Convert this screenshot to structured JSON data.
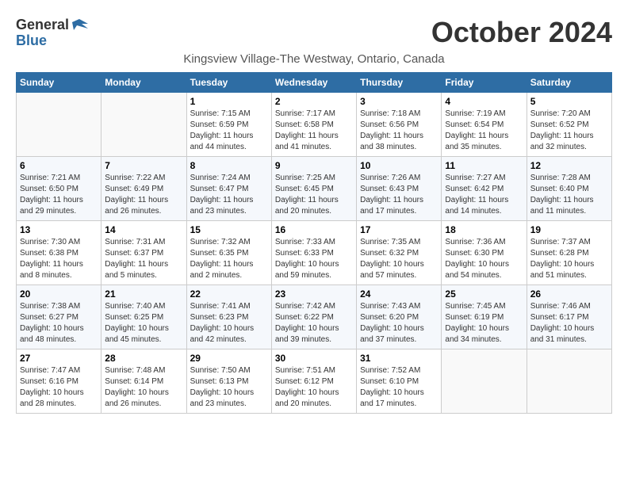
{
  "logo": {
    "general": "General",
    "blue": "Blue"
  },
  "title": "October 2024",
  "subtitle": "Kingsview Village-The Westway, Ontario, Canada",
  "days_of_week": [
    "Sunday",
    "Monday",
    "Tuesday",
    "Wednesday",
    "Thursday",
    "Friday",
    "Saturday"
  ],
  "weeks": [
    [
      {
        "day": "",
        "info": ""
      },
      {
        "day": "",
        "info": ""
      },
      {
        "day": "1",
        "info": "Sunrise: 7:15 AM\nSunset: 6:59 PM\nDaylight: 11 hours and 44 minutes."
      },
      {
        "day": "2",
        "info": "Sunrise: 7:17 AM\nSunset: 6:58 PM\nDaylight: 11 hours and 41 minutes."
      },
      {
        "day": "3",
        "info": "Sunrise: 7:18 AM\nSunset: 6:56 PM\nDaylight: 11 hours and 38 minutes."
      },
      {
        "day": "4",
        "info": "Sunrise: 7:19 AM\nSunset: 6:54 PM\nDaylight: 11 hours and 35 minutes."
      },
      {
        "day": "5",
        "info": "Sunrise: 7:20 AM\nSunset: 6:52 PM\nDaylight: 11 hours and 32 minutes."
      }
    ],
    [
      {
        "day": "6",
        "info": "Sunrise: 7:21 AM\nSunset: 6:50 PM\nDaylight: 11 hours and 29 minutes."
      },
      {
        "day": "7",
        "info": "Sunrise: 7:22 AM\nSunset: 6:49 PM\nDaylight: 11 hours and 26 minutes."
      },
      {
        "day": "8",
        "info": "Sunrise: 7:24 AM\nSunset: 6:47 PM\nDaylight: 11 hours and 23 minutes."
      },
      {
        "day": "9",
        "info": "Sunrise: 7:25 AM\nSunset: 6:45 PM\nDaylight: 11 hours and 20 minutes."
      },
      {
        "day": "10",
        "info": "Sunrise: 7:26 AM\nSunset: 6:43 PM\nDaylight: 11 hours and 17 minutes."
      },
      {
        "day": "11",
        "info": "Sunrise: 7:27 AM\nSunset: 6:42 PM\nDaylight: 11 hours and 14 minutes."
      },
      {
        "day": "12",
        "info": "Sunrise: 7:28 AM\nSunset: 6:40 PM\nDaylight: 11 hours and 11 minutes."
      }
    ],
    [
      {
        "day": "13",
        "info": "Sunrise: 7:30 AM\nSunset: 6:38 PM\nDaylight: 11 hours and 8 minutes."
      },
      {
        "day": "14",
        "info": "Sunrise: 7:31 AM\nSunset: 6:37 PM\nDaylight: 11 hours and 5 minutes."
      },
      {
        "day": "15",
        "info": "Sunrise: 7:32 AM\nSunset: 6:35 PM\nDaylight: 11 hours and 2 minutes."
      },
      {
        "day": "16",
        "info": "Sunrise: 7:33 AM\nSunset: 6:33 PM\nDaylight: 10 hours and 59 minutes."
      },
      {
        "day": "17",
        "info": "Sunrise: 7:35 AM\nSunset: 6:32 PM\nDaylight: 10 hours and 57 minutes."
      },
      {
        "day": "18",
        "info": "Sunrise: 7:36 AM\nSunset: 6:30 PM\nDaylight: 10 hours and 54 minutes."
      },
      {
        "day": "19",
        "info": "Sunrise: 7:37 AM\nSunset: 6:28 PM\nDaylight: 10 hours and 51 minutes."
      }
    ],
    [
      {
        "day": "20",
        "info": "Sunrise: 7:38 AM\nSunset: 6:27 PM\nDaylight: 10 hours and 48 minutes."
      },
      {
        "day": "21",
        "info": "Sunrise: 7:40 AM\nSunset: 6:25 PM\nDaylight: 10 hours and 45 minutes."
      },
      {
        "day": "22",
        "info": "Sunrise: 7:41 AM\nSunset: 6:23 PM\nDaylight: 10 hours and 42 minutes."
      },
      {
        "day": "23",
        "info": "Sunrise: 7:42 AM\nSunset: 6:22 PM\nDaylight: 10 hours and 39 minutes."
      },
      {
        "day": "24",
        "info": "Sunrise: 7:43 AM\nSunset: 6:20 PM\nDaylight: 10 hours and 37 minutes."
      },
      {
        "day": "25",
        "info": "Sunrise: 7:45 AM\nSunset: 6:19 PM\nDaylight: 10 hours and 34 minutes."
      },
      {
        "day": "26",
        "info": "Sunrise: 7:46 AM\nSunset: 6:17 PM\nDaylight: 10 hours and 31 minutes."
      }
    ],
    [
      {
        "day": "27",
        "info": "Sunrise: 7:47 AM\nSunset: 6:16 PM\nDaylight: 10 hours and 28 minutes."
      },
      {
        "day": "28",
        "info": "Sunrise: 7:48 AM\nSunset: 6:14 PM\nDaylight: 10 hours and 26 minutes."
      },
      {
        "day": "29",
        "info": "Sunrise: 7:50 AM\nSunset: 6:13 PM\nDaylight: 10 hours and 23 minutes."
      },
      {
        "day": "30",
        "info": "Sunrise: 7:51 AM\nSunset: 6:12 PM\nDaylight: 10 hours and 20 minutes."
      },
      {
        "day": "31",
        "info": "Sunrise: 7:52 AM\nSunset: 6:10 PM\nDaylight: 10 hours and 17 minutes."
      },
      {
        "day": "",
        "info": ""
      },
      {
        "day": "",
        "info": ""
      }
    ]
  ]
}
